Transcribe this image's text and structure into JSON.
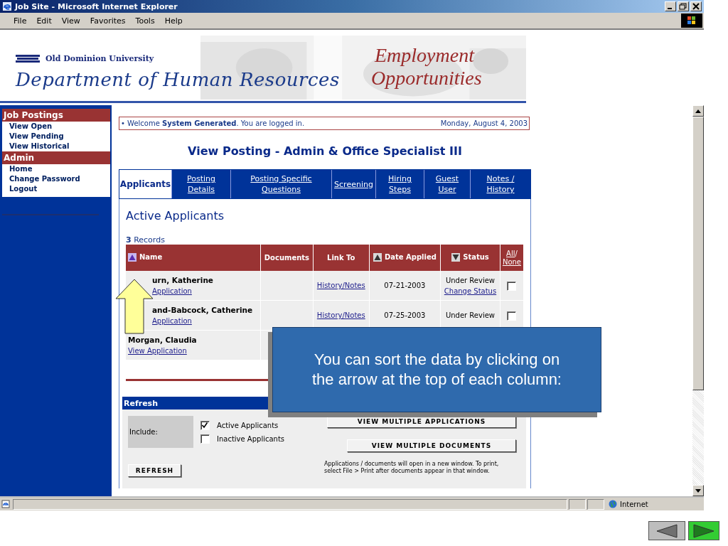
{
  "window": {
    "title": "Job Site - Microsoft Internet Explorer"
  },
  "menu": [
    "File",
    "Edit",
    "View",
    "Favorites",
    "Tools",
    "Help"
  ],
  "banner": {
    "university": "Old Dominion University",
    "department": "Department of Human Resources",
    "heading_lines": [
      "Employment",
      "Opportunities"
    ]
  },
  "sidebar": {
    "sections": [
      {
        "title": "Job Postings",
        "items": [
          "View Open",
          "View Pending",
          "View Historical"
        ]
      },
      {
        "title": "Admin",
        "items": [
          "Home",
          "Change Password",
          "Logout"
        ]
      }
    ]
  },
  "welcome": {
    "bullet": "•",
    "text": "Welcome **System Generated**. You are logged in.",
    "date": "Monday, August 4, 2003"
  },
  "page_title": "View Posting - Admin & Office Specialist III",
  "tabs": [
    {
      "label": "Applicants",
      "selected": true
    },
    {
      "label": "Posting Details",
      "selected": false
    },
    {
      "label": "Posting Specific Questions",
      "selected": false
    },
    {
      "label": "Screening",
      "selected": false
    },
    {
      "label": "Hiring Steps",
      "selected": false
    },
    {
      "label": "Guest User",
      "selected": false
    },
    {
      "label": "Notes / History",
      "selected": false
    }
  ],
  "section_title": "Active Applicants",
  "records": "**3** Records",
  "table": {
    "columns": [
      {
        "label": "Name",
        "sort_up": true,
        "active": true
      },
      {
        "label": "Documents"
      },
      {
        "label": "Link To"
      },
      {
        "label": "Date Applied",
        "sort_up": true,
        "active": false
      },
      {
        "label": "Status",
        "sort_up": false,
        "active": false
      }
    ],
    "select_all": {
      "all": "All",
      "separator": "/",
      "none": "None"
    },
    "rows": [
      {
        "name": "urn, Katherine",
        "view": "Application",
        "link": "History/Notes",
        "date": "07-21-2003",
        "status": "Under Review",
        "change": "Change Status",
        "checked": false
      },
      {
        "name": "and-Babcock, Catherine",
        "view": "Application",
        "link": "History/Notes",
        "date": "07-25-2003",
        "status": "Under Review",
        "checked": false
      },
      {
        "name": "Morgan, Claudia",
        "view": "View Application"
      }
    ]
  },
  "refresh": {
    "title": "Refresh",
    "include_label": "Include:",
    "options": [
      {
        "label": "Active Applicants",
        "checked": true
      },
      {
        "label": "Inactive Applicants",
        "checked": false
      }
    ],
    "button": "REFRESH",
    "actions": [
      "VIEW MULTIPLE APPLICATIONS",
      "VIEW MULTIPLE DOCUMENTS"
    ],
    "note": "Applications / documents will open in a new window. To print, select File > Print after documents appear in that window."
  },
  "status_bar": {
    "zone": "Internet"
  },
  "callout": {
    "text": "You can sort the data by clicking on the arrow at the top of each column:"
  },
  "slide_nav": [
    {
      "kind": "prev",
      "active": false
    },
    {
      "kind": "next",
      "active": true
    }
  ]
}
